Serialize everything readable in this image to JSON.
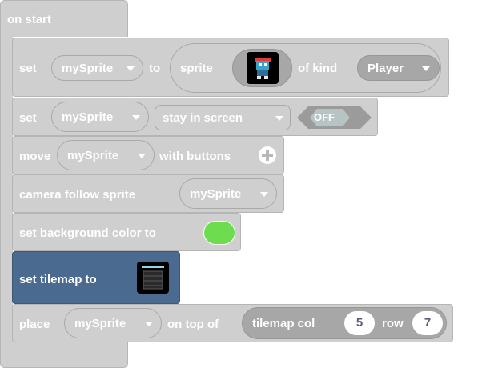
{
  "hat": {
    "label": "on start"
  },
  "blocks": [
    {
      "id": "set-sprite",
      "parts": [
        "set",
        "mySprite",
        "to",
        "sprite",
        "of kind",
        "Player"
      ]
    },
    {
      "id": "stay",
      "parts": [
        "set",
        "mySprite",
        "stay in screen",
        "OFF"
      ]
    },
    {
      "id": "move",
      "parts": [
        "move",
        "mySprite",
        "with buttons"
      ]
    },
    {
      "id": "camera",
      "parts": [
        "camera follow sprite",
        "mySprite"
      ]
    },
    {
      "id": "bg",
      "parts": [
        "set background color to"
      ],
      "color": "#6ddc4f"
    },
    {
      "id": "tilemap",
      "parts": [
        "set tilemap to"
      ],
      "color": "#4b6a8f"
    },
    {
      "id": "place",
      "parts": [
        "place",
        "mySprite",
        "on top of",
        "tilemap col",
        "5",
        "row",
        "7"
      ]
    }
  ],
  "icons": {
    "sprite_thumb": "sprite-image-icon",
    "tilemap_thumb": "tilemap-image-icon",
    "plus": "plus-circle-icon",
    "dropdown": "caret-down-icon"
  }
}
